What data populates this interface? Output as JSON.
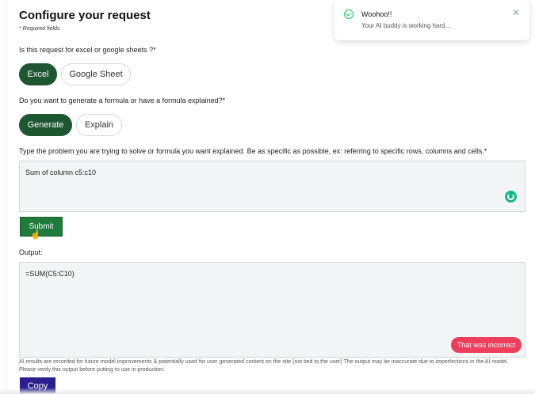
{
  "form": {
    "title": "Configure your request",
    "required_note": "* Required fields",
    "q1": "Is this request for excel or google sheets ?*",
    "q1_options": [
      "Excel",
      "Google Sheet"
    ],
    "q2": "Do you want to generate a formula or have a formula explained?*",
    "q2_options": [
      "Generate",
      "Explain"
    ],
    "q3": "Type the problem you are trying to solve or formula you want explained. Be as specific as possible, ex: referring to specific rows, columns and cells.*",
    "input_value": "Sum of column c5:c10",
    "submit_label": "Submit",
    "output_label": "Output:",
    "output_value": "=SUM(C5:C10)",
    "incorrect_label": "That was incorrect",
    "disclaimer": "AI results are recorded for future model improvements & potentially used for user generated content on the site (not tied to the user) The output may be inaccurate due to imperfections in the AI model. Please verify this output before putting to use in production.",
    "copy_label": "Copy"
  },
  "toast": {
    "title": "Woohoo!!",
    "message": "Your AI buddy is working hard..."
  },
  "icons": {
    "check": "check-circle-icon",
    "close": "close-icon",
    "spinner": "loading-icon",
    "cursor": "pointer-cursor-icon"
  },
  "colors": {
    "active_green": "#1e5631",
    "submit_green": "#1e7b3a",
    "copy_purple": "#2b1f8f",
    "incorrect_red": "#ef3e5c",
    "spinner_teal": "#10b981"
  }
}
